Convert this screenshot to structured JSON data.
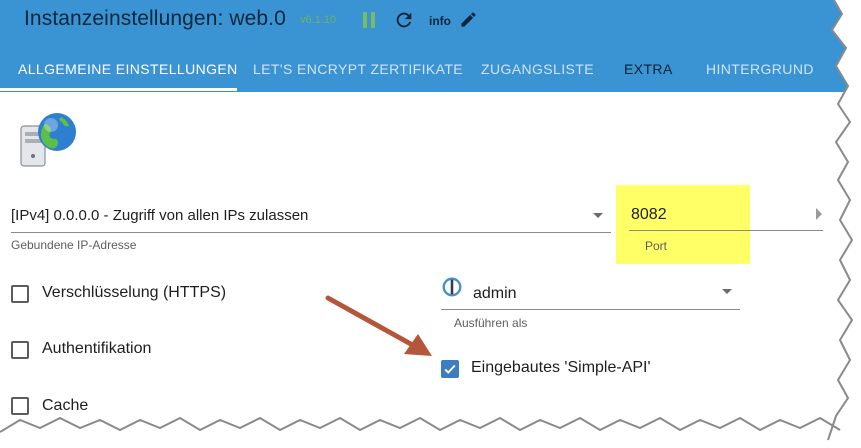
{
  "header": {
    "title": "Instanzeinstellungen: web.0",
    "version": "v6.1.10",
    "info_label": "info",
    "icons": [
      "pause-icon",
      "refresh-icon",
      "pencil-icon"
    ],
    "accent_color": "#3a93d2"
  },
  "tabs": [
    {
      "label": "ALLGEMEINE EINSTELLUNGEN",
      "active": true
    },
    {
      "label": "LET'S ENCRYPT ZERTIFIKATE",
      "active": false
    },
    {
      "label": "ZUGANGSLISTE",
      "active": false
    },
    {
      "label": "EXTRA",
      "active": false
    },
    {
      "label": "HINTERGRUND",
      "active": false
    }
  ],
  "form": {
    "ip_select": {
      "value": "[IPv4] 0.0.0.0 - Zugriff von allen IPs zulassen",
      "helper": "Gebundene IP-Adresse"
    },
    "port": {
      "value": "8082",
      "helper": "Port",
      "highlight_color": "#ffff66"
    },
    "checkboxes": [
      {
        "label": "Verschlüsselung (HTTPS)",
        "checked": false
      },
      {
        "label": "Authentifikation",
        "checked": false
      },
      {
        "label": "Cache",
        "checked": false
      },
      {
        "label": "Eingebautes 'Simple-API'",
        "checked": true
      }
    ],
    "run_as": {
      "value": "admin",
      "helper": "Ausführen als"
    }
  }
}
